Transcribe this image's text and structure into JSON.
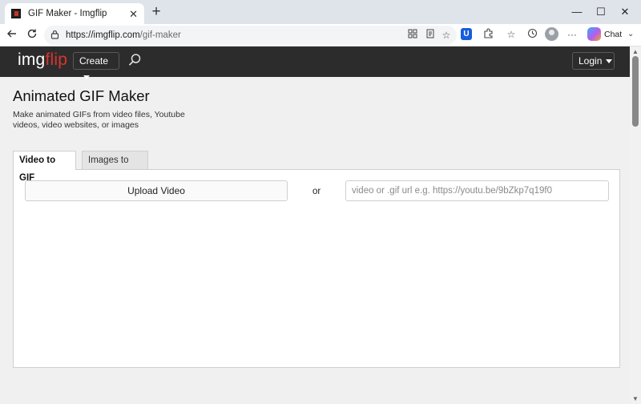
{
  "browser": {
    "tab_title": "GIF Maker - Imgflip",
    "tab_close": "✕",
    "new_tab": "+",
    "url_host": "https://imgflip.com",
    "url_path": "/gif-maker",
    "chat_label": "Chat",
    "window_controls": [
      "—",
      "☐",
      "✕"
    ],
    "icons": [
      "back-icon",
      "refresh-icon",
      "lock-icon",
      "apps-icon",
      "reader-icon",
      "favorite-star-icon",
      "bitwarden-icon",
      "extensions-icon",
      "favorites-icon",
      "history-icon",
      "profile-icon",
      "more-icon",
      "copilot-icon"
    ]
  },
  "site": {
    "logo_main": "img",
    "logo_flip": "flip",
    "create_label": "Create",
    "login_label": "Login",
    "brand_color": "#d9352c",
    "nav_bg": "#2c2c2c"
  },
  "main": {
    "title": "Animated GIF Maker",
    "subtitle": "Make animated GIFs from video files, Youtube videos, video websites, or images",
    "tabs": [
      {
        "label": "Video to GIF",
        "active": true
      },
      {
        "label": "Images to GIF",
        "active": false
      }
    ],
    "upload_label": "Upload Video",
    "or_text": "or",
    "url_placeholder": "video or .gif url e.g. https://youtu.be/9bZkp7q19f0"
  }
}
